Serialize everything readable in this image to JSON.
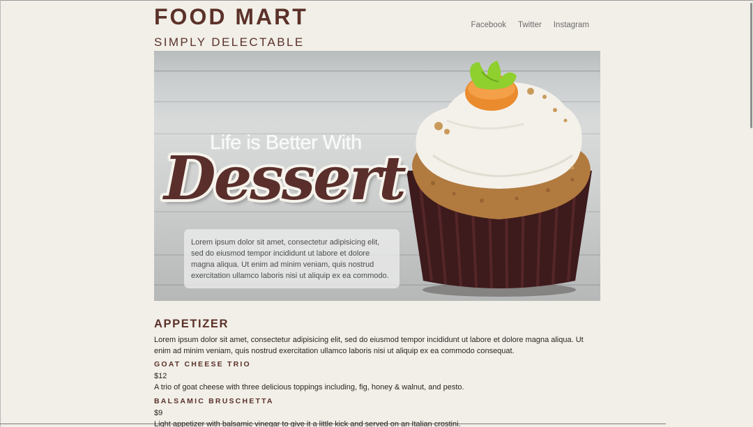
{
  "header": {
    "brand": "FOOD MART",
    "tagline": "SIMPLY DELECTABLE"
  },
  "nav": {
    "links": [
      "Facebook",
      "Twitter",
      "Instagram"
    ]
  },
  "hero": {
    "kicker": "Life is Better With",
    "heading": "Dessert",
    "card_text": "Lorem ipsum dolor sit amet, consectetur adipisicing elit, sed do eiusmod tempor incididunt ut labore et dolore magna aliqua. Ut enim ad minim veniam, quis nostrud exercitation ullamco laboris nisi ut aliquip ex ea commodo."
  },
  "menu": {
    "section_title": "APPETIZER",
    "section_desc": "Lorem ipsum dolor sit amet, consectetur adipisicing elit, sed do eiusmod tempor incididunt ut labore et dolore magna aliqua. Ut enim ad minim veniam, quis nostrud exercitation ullamco laboris nisi ut aliquip ex ea commodo consequat.",
    "items": [
      {
        "name": "GOAT CHEESE TRIO",
        "price": "$12",
        "desc": "A trio of goat cheese with three delicious toppings including, fig, honey & walnut, and pesto."
      },
      {
        "name": "BALSAMIC BRUSCHETTA",
        "price": "$9",
        "desc": "Light appetizer with balsamic vinegar to give it a little kick and served on an Italian crostini."
      }
    ]
  },
  "colors": {
    "background": "#f1efe8",
    "brand": "#5b3129",
    "nav_text": "#6b6b6b"
  }
}
